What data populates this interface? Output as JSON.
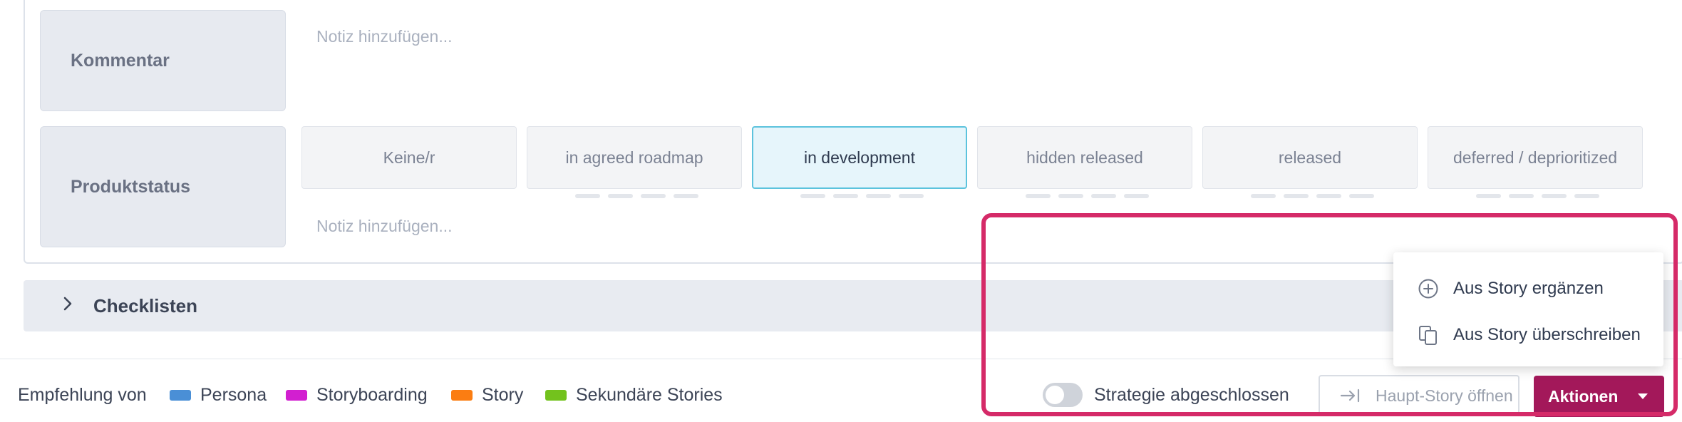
{
  "fields": {
    "comment": {
      "label": "Kommentar",
      "note_placeholder": "Notiz hinzufügen..."
    },
    "product_status": {
      "label": "Produktstatus",
      "note_placeholder": "Notiz hinzufügen...",
      "options": [
        "Keine/r",
        "in agreed roadmap",
        "in development",
        "hidden released",
        "released",
        "deferred / deprioritized"
      ],
      "selected": "in development"
    }
  },
  "checklists": {
    "label": "Checklisten"
  },
  "footer": {
    "recommendation_label": "Empfehlung von",
    "legend": [
      {
        "label": "Persona",
        "color": "#4a8fd6"
      },
      {
        "label": "Storyboarding",
        "color": "#d21fd0"
      },
      {
        "label": "Story",
        "color": "#fb7d12"
      },
      {
        "label": "Sekundäre Stories",
        "color": "#73c21d"
      }
    ],
    "strategy_toggle_label": "Strategie abgeschlossen",
    "strategy_toggle_on": false,
    "open_main_story_label": "Haupt-Story öffnen",
    "actions_label": "Aktionen",
    "actions_color": "#a3185a"
  },
  "actions_menu": {
    "items": [
      {
        "label": "Aus Story ergänzen",
        "icon": "plus-circle-icon"
      },
      {
        "label": "Aus Story überschreiben",
        "icon": "copy-icon"
      }
    ]
  },
  "highlight_color": "#d52a68"
}
